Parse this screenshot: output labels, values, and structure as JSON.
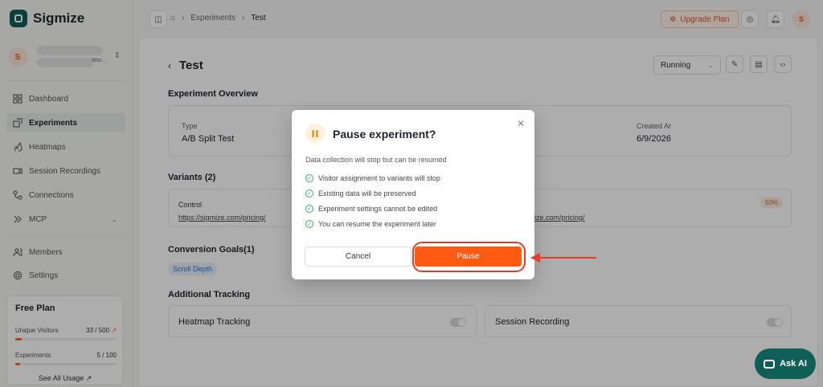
{
  "brand": {
    "name": "Sigmize"
  },
  "workspace": {
    "initial": "S",
    "subtitle": "Wor..."
  },
  "sidebar": {
    "items": [
      {
        "label": "Dashboard",
        "icon": "dashboard-icon"
      },
      {
        "label": "Experiments",
        "icon": "experiments-icon"
      },
      {
        "label": "Heatmaps",
        "icon": "heatmaps-icon"
      },
      {
        "label": "Session Recordings",
        "icon": "video-icon"
      },
      {
        "label": "Connections",
        "icon": "connections-icon"
      },
      {
        "label": "MCP",
        "icon": "mcp-icon"
      },
      {
        "label": "Members",
        "icon": "members-icon"
      },
      {
        "label": "Settings",
        "icon": "gear-icon"
      }
    ],
    "plan": {
      "title": "Free Plan",
      "visitors_label": "Unique Visitors",
      "visitors_value": "33 / 500",
      "visitors_fraction": 0.066,
      "experiments_label": "Experiments",
      "experiments_value": "5 / 100",
      "experiments_fraction": 0.05,
      "see_all": "See All Usage"
    }
  },
  "topbar": {
    "breadcrumb": [
      "Experiments",
      "Test"
    ],
    "upgrade_label": "Upgrade Plan",
    "user_initial": "S"
  },
  "page": {
    "title": "Test",
    "status": "Running",
    "overview_heading": "Experiment Overview",
    "type_label": "Type",
    "type_value": "A/B Split Test",
    "created_label": "Created At",
    "created_value": "6/9/2026",
    "variants_heading": "Variants (2)",
    "control_label": "Control",
    "control_url": "https://sigmize.com/pricing/",
    "variant_url_partial": "ize.com/pricing/",
    "variant_pct": "50%",
    "goals_heading": "Conversion Goals(1)",
    "goal_tag": "Scroll Depth",
    "tracking_heading": "Additional Tracking",
    "heatmap_label": "Heatmap Tracking",
    "session_label": "Session Recording"
  },
  "modal": {
    "title": "Pause experiment?",
    "description": "Data collection will stop but can be resumed",
    "items": [
      "Visitor assignment to variants will stop",
      "Existing data will be preserved",
      "Experiment settings cannot be edited",
      "You can resume the experiment later"
    ],
    "cancel_label": "Cancel",
    "pause_label": "Pause"
  },
  "ask_ai": {
    "label": "Ask AI"
  },
  "colors": {
    "accent": "#ff5a12",
    "brand": "#0f5f57",
    "annotation": "#e53b2c"
  }
}
